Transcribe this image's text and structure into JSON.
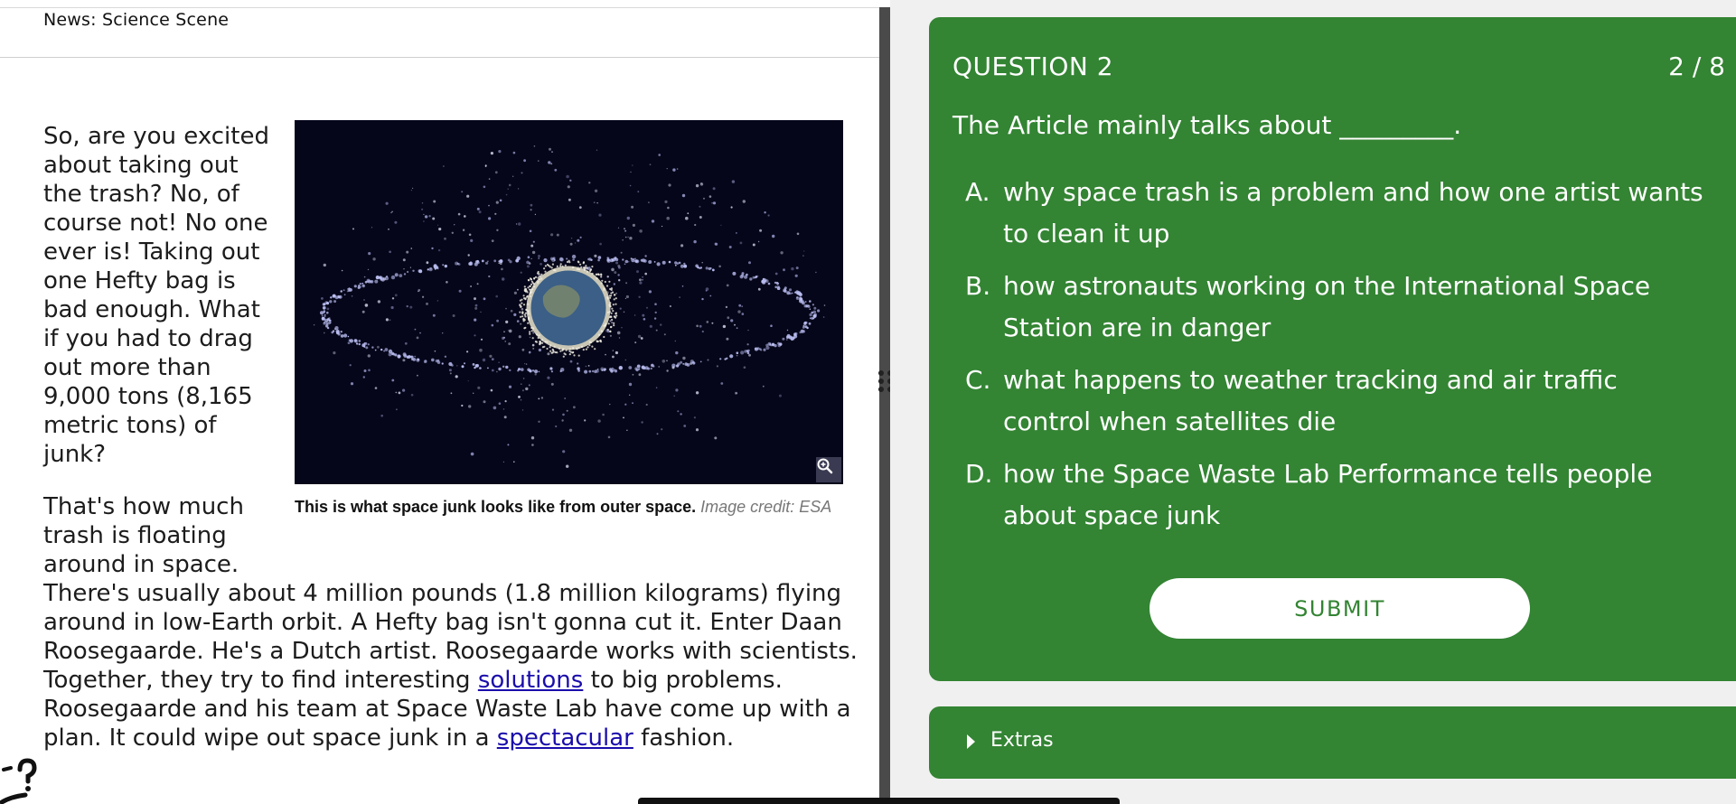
{
  "article": {
    "source": "News: Science Scene",
    "para1": "So, are you excited about taking out the trash? No, of course not! No one ever is! Taking out one Hefty bag is bad enough. What if you had to drag out more than 9,000 tons (8,165 metric tons) of junk?",
    "para2": "That's how much trash is floating around in space.",
    "para3_before": "There's usually about 4 million pounds (1.8 million kilograms) flying around in low-Earth orbit. A Hefty bag isn't gonna cut it. Enter Daan Roosegaarde. He's a Dutch artist. Roosegaarde works with scientists. Together, they try to find interesting ",
    "link_solutions": "solutions",
    "para3_middle": " to big problems. Roosegaarde and his team at Space Waste Lab have come up with a plan. It could wipe out space junk in a ",
    "link_spectacular": "spectacular",
    "para3_after": " fashion.",
    "figure": {
      "caption_bold": "This is what space junk looks like from outer space.",
      "caption_credit": "Image credit: ESA",
      "zoom_icon": "zoom-in-icon"
    }
  },
  "quiz": {
    "question_number": "QUESTION 2",
    "progress": "2 / 8",
    "question_text": "The Article mainly talks about _________.",
    "options": [
      {
        "letter": "A.",
        "text": "why space trash is a problem and how one artist wants to clean it up"
      },
      {
        "letter": "B.",
        "text": "how astronauts working on the International Space Station are in danger"
      },
      {
        "letter": "C.",
        "text": "what happens to weather tracking and air traffic control when satellites die"
      },
      {
        "letter": "D.",
        "text": "how the Space Waste Lab Performance tells people about space junk"
      }
    ],
    "submit_label": "SUBMIT",
    "extras_label": "Extras"
  },
  "colors": {
    "card_green": "#338433",
    "link_blue": "#1a0dab",
    "divider": "#4a4a4a"
  }
}
